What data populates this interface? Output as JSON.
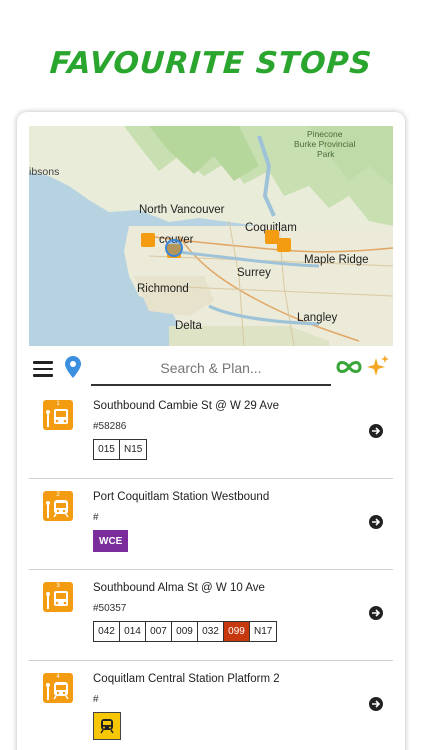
{
  "headline": "FAVOURITE STOPS",
  "map": {
    "labels": {
      "pinecone": "Pinecone",
      "burke": "Burke Provincial",
      "park": "Park",
      "gibsons": "ibsons",
      "north_vancouver": "North Vancouver",
      "vancouver": "couver",
      "coquitlam": "Coquitlam",
      "maple_ridge": "Maple Ridge",
      "surrey": "Surrey",
      "richmond": "Richmond",
      "langley": "Langley",
      "delta": "Delta"
    }
  },
  "toolbar": {
    "menu_icon": "hamburger-menu-icon",
    "location_icon": "location-pin-icon",
    "search_placeholder": "Search & Plan...",
    "loop_icon": "infinity-icon",
    "sparkle_icon": "sparkle-icon"
  },
  "colors": {
    "headline": "#2aa62f",
    "stop_icon": "#f39c12",
    "route_highlight": "#c8380f",
    "wce": "#7b2d9c",
    "train": "#f7c705"
  },
  "stops": [
    {
      "number": "1",
      "icon": "bus-stop-icon",
      "title": "Southbound Cambie St @ W 29 Ave",
      "code": "#58286",
      "routes": [
        "015",
        "N15"
      ]
    },
    {
      "number": "2",
      "icon": "train-station-icon",
      "title": "Port Coquitlam Station Westbound",
      "code": "#",
      "routes": [
        "WCE"
      ]
    },
    {
      "number": "3",
      "icon": "bus-stop-icon",
      "title": "Southbound Alma St @ W 10 Ave",
      "code": "#50357",
      "routes": [
        "042",
        "014",
        "007",
        "009",
        "032",
        "099",
        "N17"
      ]
    },
    {
      "number": "4",
      "icon": "train-station-icon",
      "title": "Coquitlam Central Station Platform 2",
      "code": "#",
      "routes": [
        "skytrain"
      ]
    }
  ]
}
